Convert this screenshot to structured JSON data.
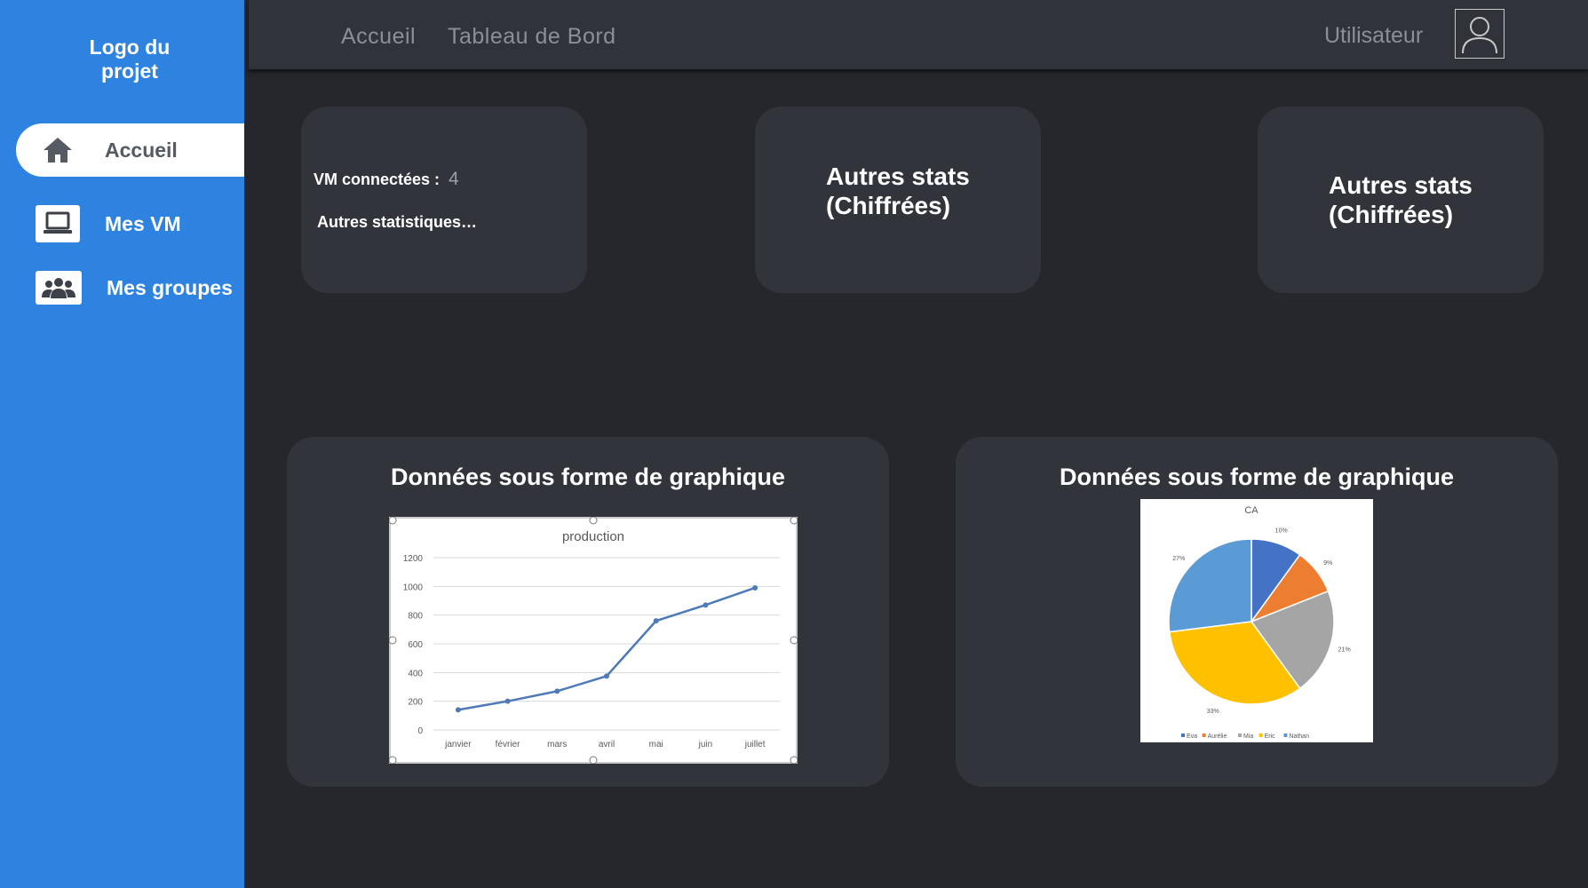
{
  "sidebar": {
    "logo": "Logo du\nprojet",
    "items": [
      {
        "label": "Accueil",
        "icon": "home-icon",
        "active": true
      },
      {
        "label": "Mes VM",
        "icon": "laptop-icon",
        "active": false
      },
      {
        "label": "Mes groupes",
        "icon": "users-icon",
        "active": false
      }
    ]
  },
  "topbar": {
    "links": [
      "Accueil",
      "Tableau de Bord"
    ],
    "user_label": "Utilisateur",
    "avatar_icon": "user-avatar-icon"
  },
  "stats": {
    "vm_label": "VM connectées :",
    "vm_value": "4",
    "other_label": "Autres statistiques…",
    "card2": "Autres stats\n(Chiffrées)",
    "card3": "Autres stats\n(Chiffrées)"
  },
  "charts": {
    "title_left": "Données sous forme de graphique",
    "title_right": "Données sous forme de graphique"
  },
  "colors": {
    "sidebar": "#2f83e0",
    "background": "#25272c",
    "card": "#31343a",
    "line": "#4f7ab8"
  },
  "chart_data": [
    {
      "type": "line",
      "title": "production",
      "categories": [
        "janvier",
        "février",
        "mars",
        "avril",
        "mai",
        "juin",
        "juillet"
      ],
      "values": [
        140,
        200,
        270,
        375,
        760,
        870,
        990
      ],
      "ylim": [
        0,
        1200
      ],
      "yticks": [
        0,
        200,
        400,
        600,
        800,
        1000,
        1200
      ],
      "grid": true
    },
    {
      "type": "pie",
      "title": "CA",
      "slices": [
        {
          "name": "Eva",
          "value": 10,
          "label": "10%",
          "color": "#4472c4"
        },
        {
          "name": "Aurélie",
          "value": 9,
          "label": "9%",
          "color": "#ed7d31"
        },
        {
          "name": "Mia",
          "value": 21,
          "label": "21%",
          "color": "#a5a5a5"
        },
        {
          "name": "Eric",
          "value": 33,
          "label": "33%",
          "color": "#ffc000"
        },
        {
          "name": "Nathan",
          "value": 27,
          "label": "27%",
          "color": "#5b9bd5"
        }
      ],
      "legend": "bottom"
    }
  ]
}
